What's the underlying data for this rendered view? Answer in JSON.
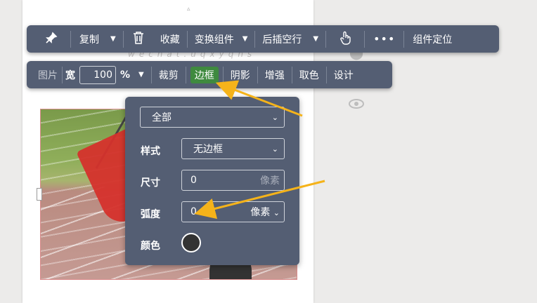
{
  "toolbar_main": {
    "pin_icon": "pin-icon",
    "copy_label": "复制",
    "delete_icon": "trash-icon",
    "favorite_label": "收藏",
    "transform_label": "变换组件",
    "insert_blank_label": "后插空行",
    "touch_icon": "touch-icon",
    "more_icon": "more-icon",
    "more_text": "•••",
    "locate_label": "组件定位"
  },
  "toolbar_image": {
    "image_label": "图片",
    "width_label": "宽",
    "zoom_value": "100",
    "percent": "%",
    "crop_label": "裁剪",
    "border_label": "边框",
    "shadow_label": "阴影",
    "enhance_label": "增强",
    "pick_color_label": "取色",
    "design_label": "设计"
  },
  "border_panel": {
    "scope_value": "全部",
    "style_label": "样式",
    "style_value": "无边框",
    "size_label": "尺寸",
    "size_value": "0",
    "size_unit": "像素",
    "radius_label": "弧度",
    "radius_value": "0",
    "radius_unit": "像素",
    "color_label": "颜色",
    "color_value": "#333333"
  },
  "background": {
    "faint_sub": "wechat.uqxyqns"
  },
  "colors": {
    "toolbar_bg": "#545e73",
    "active_green": "#3f8a3f",
    "annotation_arrow": "#f5b31a"
  }
}
